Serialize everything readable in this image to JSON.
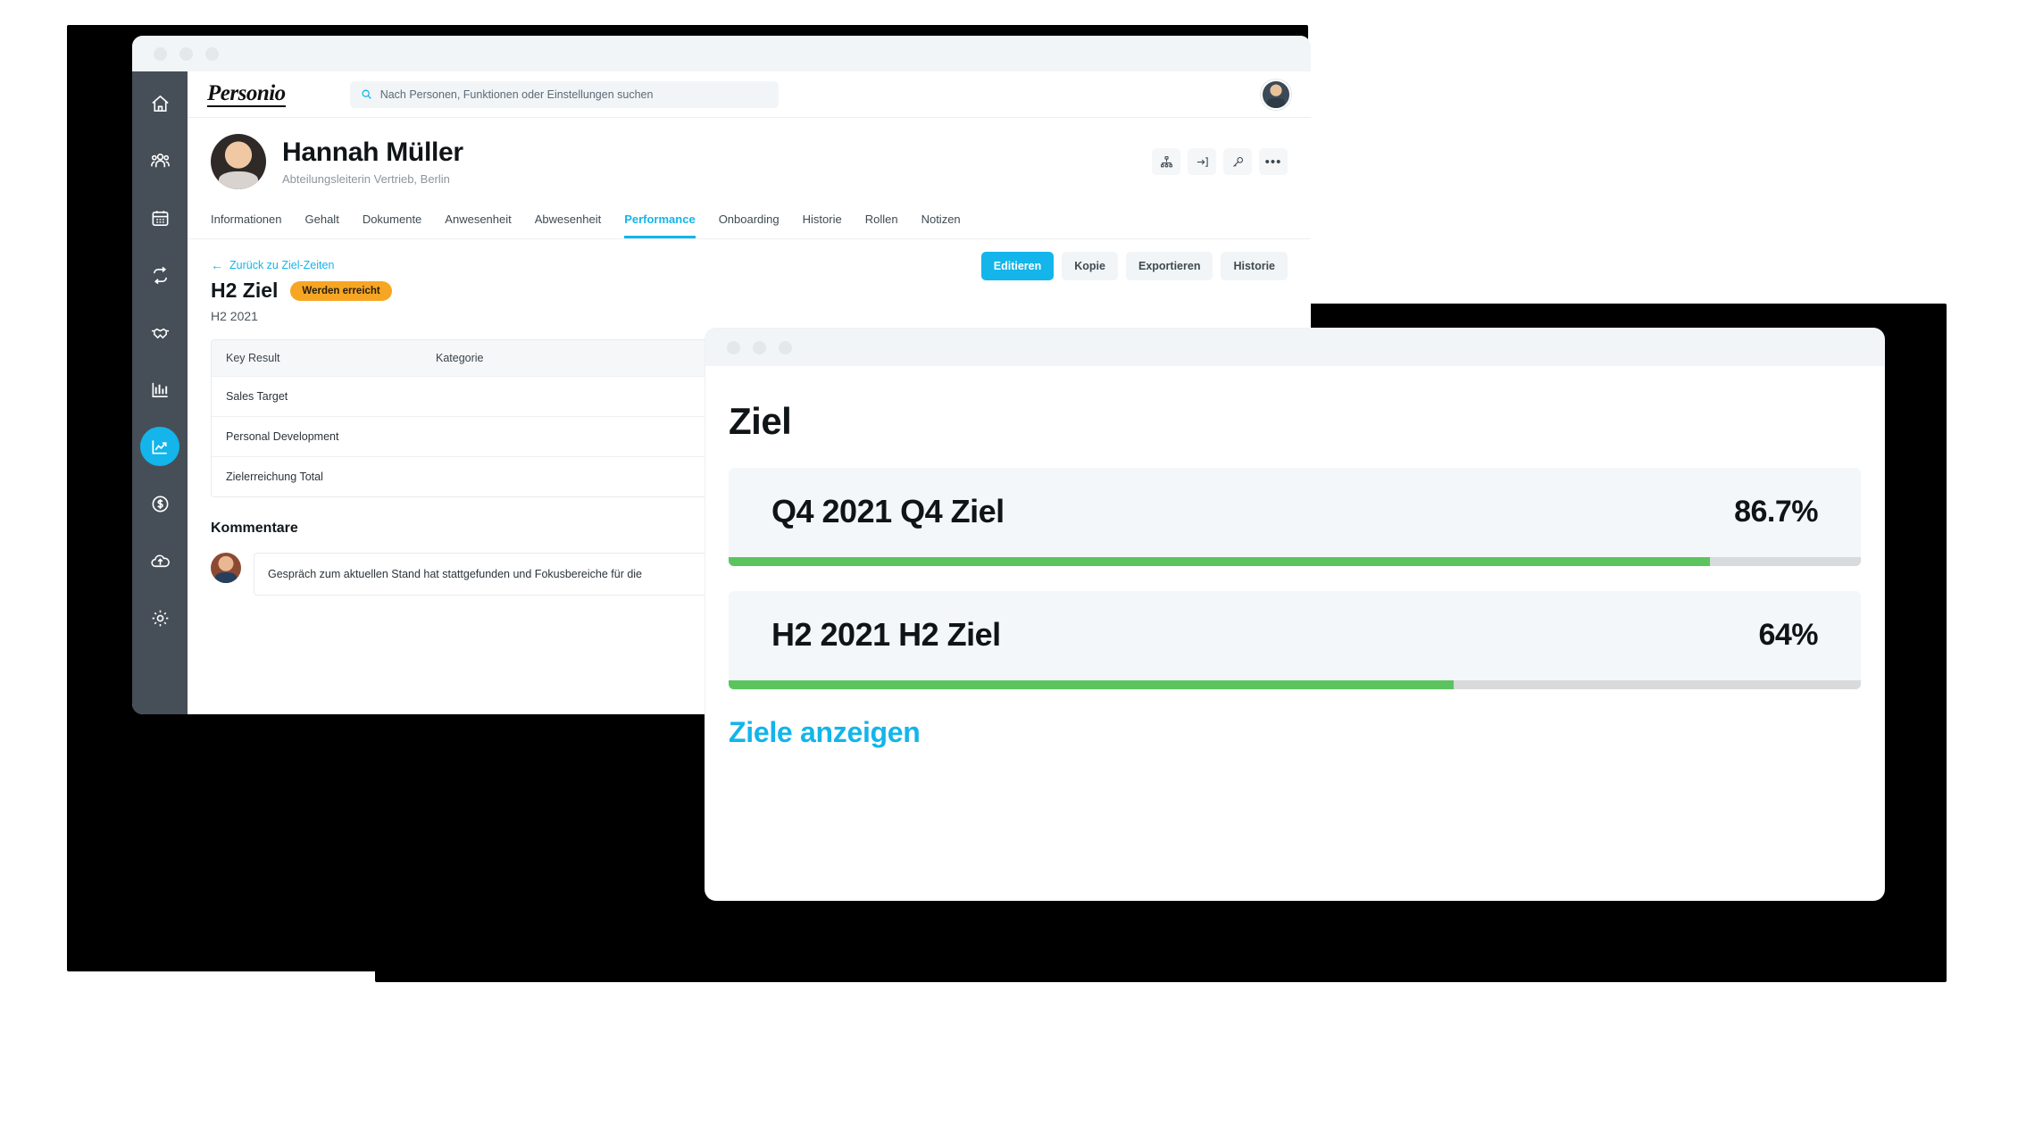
{
  "app": {
    "logo_text": "Personio",
    "accent_color": "#13b5ea",
    "badge_color": "#f7a623",
    "progress_color": "#5cc45e",
    "rail_color": "#464f58"
  },
  "search": {
    "placeholder": "Nach Personen, Funktionen oder Einstellungen suchen",
    "value": "",
    "icon": "search-icon"
  },
  "sidebar": {
    "items": [
      {
        "name": "home",
        "icon": "home-icon",
        "active": false
      },
      {
        "name": "employees",
        "icon": "people-icon",
        "active": false
      },
      {
        "name": "calendar",
        "icon": "calendar-icon",
        "active": false
      },
      {
        "name": "workflows",
        "icon": "loop-arrows-icon",
        "active": false
      },
      {
        "name": "recruiting",
        "icon": "handshake-icon",
        "active": false
      },
      {
        "name": "reports",
        "icon": "bar-chart-icon",
        "active": false
      },
      {
        "name": "performance",
        "icon": "trend-chart-icon",
        "active": true
      },
      {
        "name": "payroll",
        "icon": "dollar-circle-icon",
        "active": false
      },
      {
        "name": "documents-upload",
        "icon": "cloud-upload-icon",
        "active": false
      },
      {
        "name": "settings",
        "icon": "gear-icon",
        "active": false
      }
    ]
  },
  "profile": {
    "name": "Hannah Müller",
    "role": "Abteilungsleiterin Vertrieb, Berlin",
    "avatar": "employee-avatar",
    "header_icons": [
      {
        "name": "org-chart-icon",
        "label": "Organigramm"
      },
      {
        "name": "login-as-icon",
        "label": "Anmelden als"
      },
      {
        "name": "key-icon",
        "label": "Zugang"
      },
      {
        "name": "more-options-icon",
        "label": "..."
      }
    ]
  },
  "tabs": [
    {
      "label": "Informationen",
      "active": false
    },
    {
      "label": "Gehalt",
      "active": false
    },
    {
      "label": "Dokumente",
      "active": false
    },
    {
      "label": "Anwesenheit",
      "active": false
    },
    {
      "label": "Abwesenheit",
      "active": false
    },
    {
      "label": "Performance",
      "active": true
    },
    {
      "label": "Onboarding",
      "active": false
    },
    {
      "label": "Historie",
      "active": false
    },
    {
      "label": "Rollen",
      "active": false
    },
    {
      "label": "Notizen",
      "active": false
    }
  ],
  "goal_detail": {
    "back_link": "Zurück zu Ziel-Zeiten",
    "back_arrow": "←",
    "title": "H2 Ziel",
    "status_badge": "Werden erreicht",
    "period": "H2 2021",
    "actions": [
      {
        "label": "Editieren",
        "primary": true
      },
      {
        "label": "Kopie",
        "primary": false
      },
      {
        "label": "Exportieren",
        "primary": false
      },
      {
        "label": "Historie",
        "primary": false
      }
    ],
    "table": {
      "columns": [
        "Key Result",
        "Kategorie"
      ],
      "rows": [
        {
          "key_result": "Sales Target",
          "kategorie": ""
        },
        {
          "key_result": "Personal Development",
          "kategorie": ""
        },
        {
          "key_result": "Zielerreichung Total",
          "kategorie": ""
        }
      ]
    },
    "comments": {
      "title": "Kommentare",
      "entries": [
        {
          "author_avatar": "commenter-avatar",
          "text": "Gespräch zum aktuellen Stand hat stattgefunden und Fokusbereiche für die"
        }
      ]
    }
  },
  "modal": {
    "title": "Ziel",
    "window_dots": 3,
    "goals": [
      {
        "label": "Q4 2021 Q4 Ziel",
        "percent_label": "86.7%",
        "percent": 86.7
      },
      {
        "label": "H2 2021 H2 Ziel",
        "percent_label": "64%",
        "percent": 64
      }
    ],
    "link": "Ziele anzeigen"
  }
}
